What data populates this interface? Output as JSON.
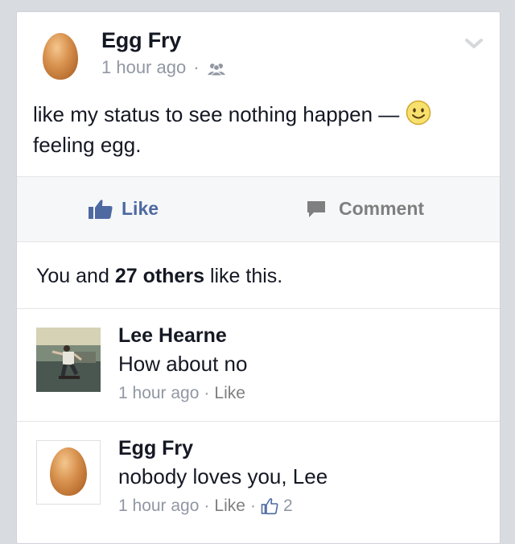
{
  "post": {
    "author": "Egg Fry",
    "time": "1 hour ago",
    "separator": "·",
    "audience_icon": "friends-icon",
    "status_text": "like my status to see nothing happen —",
    "feeling_text": "feeling egg.",
    "feeling_icon": "smiley-emoji-icon"
  },
  "actions": {
    "like_label": "Like",
    "comment_label": "Comment"
  },
  "likes_summary": {
    "prefix": "You and",
    "count": "27 others",
    "suffix": "like this."
  },
  "comments": [
    {
      "author": "Lee Hearne",
      "text": "How about no",
      "time": "1 hour ago",
      "separator": "·",
      "like_label": "Like"
    },
    {
      "author": "Egg Fry",
      "text": "nobody loves you, Lee",
      "time": "1 hour ago",
      "separator": "·",
      "like_label": "Like",
      "separator2": "·",
      "likes_count": "2"
    }
  ],
  "colors": {
    "background": "#d8dbe0",
    "link_blue": "#4e69a2",
    "meta_gray": "#9197a3",
    "text": "#141823"
  }
}
